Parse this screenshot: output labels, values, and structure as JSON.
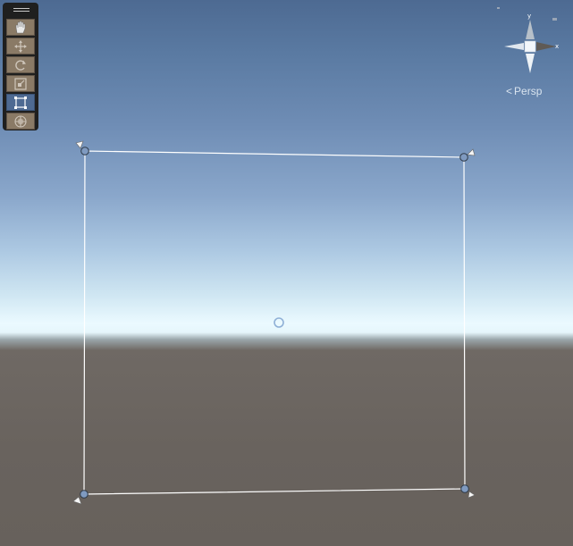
{
  "scene_view": {
    "projection_label": "Persp",
    "axis_labels": {
      "y": "y",
      "x": "x"
    },
    "colors": {
      "sky_top": "#4d6a92",
      "horizon": "#ebfaff",
      "ground": "#69635e",
      "selection_outline": "#ffffff",
      "handle_fill": "#7f9ac0",
      "toolbar_active": "#4e6a92",
      "toolbar_button": "#8a7a66"
    }
  },
  "toolbar": {
    "tools": [
      {
        "name": "hand-tool",
        "icon": "hand-icon",
        "active": false
      },
      {
        "name": "move-tool",
        "icon": "move-arrows-icon",
        "active": false
      },
      {
        "name": "rotate-tool",
        "icon": "rotate-icon",
        "active": false
      },
      {
        "name": "scale-tool",
        "icon": "scale-icon",
        "active": false
      },
      {
        "name": "rect-tool",
        "icon": "rect-transform-icon",
        "active": true
      },
      {
        "name": "transform-tool",
        "icon": "transform-icon",
        "active": false
      }
    ]
  }
}
